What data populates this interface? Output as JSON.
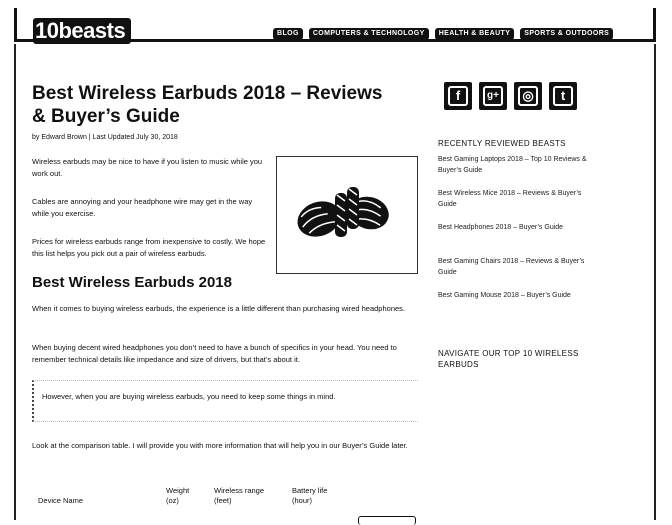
{
  "header": {
    "logo": "10beasts",
    "nav": [
      "BLOG",
      "COMPUTERS & TECHNOLOGY",
      "HEALTH & BEAUTY",
      "SPORTS & OUTDOORS"
    ]
  },
  "article": {
    "title": "Best Wireless Earbuds 2018 – Reviews & Buyer’s Guide",
    "byline": "by Edward Brown | Last Updated July 30, 2018",
    "intro": [
      "Wireless earbuds may be nice to have if you listen to music while you work out.",
      "Cables are annoying and your headphone wire may get in the way while you exercise.",
      "Prices for wireless earbuds range from inexpensive to costly. We hope this list helps you pick out a pair of wireless earbuds."
    ],
    "section_title": "Best Wireless Earbuds 2018",
    "section_paras": [
      "When it comes to buying wireless earbuds, the experience is a little different than purchasing wired headphones.",
      "When buying decent wired headphones you don’t need to have a bunch of specifics in your head. You need to remember technical details like impedance and size of drivers, but that’s about it."
    ],
    "callout": "However, when you are buying wireless earbuds, you need to keep some things in mind.",
    "comparison_text": "Look at the comparison table. I will provide you with more information that will help you in our Buyer’s Guide later.",
    "table_headers": [
      "Device Name",
      "Weight (oz)",
      "Wireless range (feet)",
      "Battery life (hour)"
    ]
  },
  "sidebar": {
    "social_icons": [
      "facebook-icon",
      "google-plus-icon",
      "instagram-icon",
      "twitter-icon"
    ],
    "social_glyphs": [
      "f",
      "g+",
      "◎",
      "t"
    ],
    "recent_title": "RECENTLY REVIEWED BEASTS",
    "recent_items": [
      "Best Gaming Laptops 2018 – Top 10 Reviews & Buyer’s Guide",
      "Best Wireless Mice 2018 – Reviews & Buyer’s Guide",
      "Best Headphones 2018 – Buyer’s Guide",
      "Best Gaming Chairs 2018 – Reviews & Buyer’s Guide",
      "Best Gaming Mouse 2018 – Buyer’s Guide"
    ],
    "navigate_title": "NAVIGATE OUR TOP 10 WIRELESS EARBUDS"
  }
}
